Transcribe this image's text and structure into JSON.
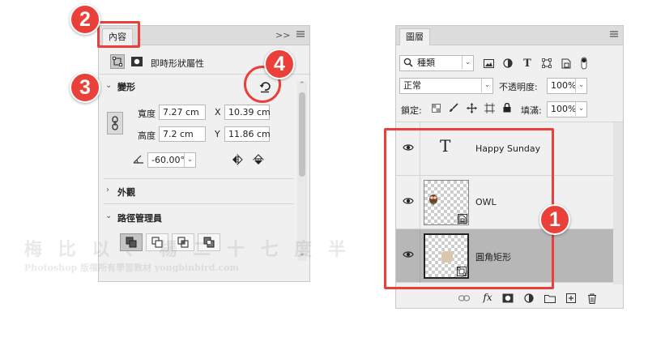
{
  "properties_panel": {
    "tab_label": "內容",
    "collapse_label": ">>",
    "header_title": "即時形狀屬性",
    "transform": {
      "title": "變形",
      "width_label": "寬度",
      "width_value": "7.27 cm",
      "height_label": "高度",
      "height_value": "7.2 cm",
      "x_label": "X",
      "x_value": "10.39 cm",
      "y_label": "Y",
      "y_value": "11.86 cm",
      "angle_value": "-60.00°"
    },
    "appearance_title": "外觀",
    "path_ops_title": "路徑管理員"
  },
  "layers_panel": {
    "tab_label": "圖層",
    "filter_value": "種類",
    "blend_mode": "正常",
    "opacity_label": "不透明度:",
    "opacity_value": "100%",
    "lock_label": "鎖定:",
    "fill_label": "填滿:",
    "fill_value": "100%",
    "layers": [
      {
        "name": "Happy Sunday",
        "type": "text"
      },
      {
        "name": "OWL",
        "type": "smart-object"
      },
      {
        "name": "圓角矩形",
        "type": "shape",
        "selected": true
      }
    ]
  },
  "callouts": [
    "1",
    "2",
    "3",
    "4"
  ],
  "watermark": {
    "line1": "梅 比 以 、 楊 二 十 七 度 半",
    "line2": "Photoshop 版權所有學習教材 yongbinbird.com"
  },
  "colors": {
    "callout_red": "#e9403a",
    "panel_bg": "#f0f0f0",
    "selected_row": "#b7b7b7"
  }
}
